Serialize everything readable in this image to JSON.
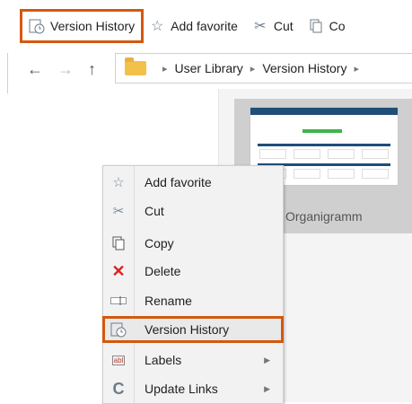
{
  "toolbar": {
    "items": [
      {
        "label": "Version History",
        "icon": "version-history-icon"
      },
      {
        "label": "Add favorite",
        "icon": "star-icon"
      },
      {
        "label": "Cut",
        "icon": "scissors-icon"
      },
      {
        "label": "Co",
        "icon": "copy-icon"
      }
    ]
  },
  "breadcrumb": [
    "User Library",
    "Version History"
  ],
  "file": {
    "name": "Organigramm"
  },
  "context_menu": {
    "items": [
      {
        "label": "Add favorite",
        "icon": "star-icon"
      },
      {
        "label": "Cut",
        "icon": "scissors-icon"
      },
      {
        "label": "Copy",
        "icon": "copy-icon"
      },
      {
        "label": "Delete",
        "icon": "delete-icon"
      },
      {
        "label": "Rename",
        "icon": "rename-icon"
      },
      {
        "label": "Version History",
        "icon": "version-history-icon"
      },
      {
        "label": "Labels",
        "icon": "labels-icon"
      },
      {
        "label": "Update Links",
        "icon": "refresh-icon"
      }
    ]
  },
  "colors": {
    "highlight": "#d4580f",
    "delete": "#e02020"
  }
}
